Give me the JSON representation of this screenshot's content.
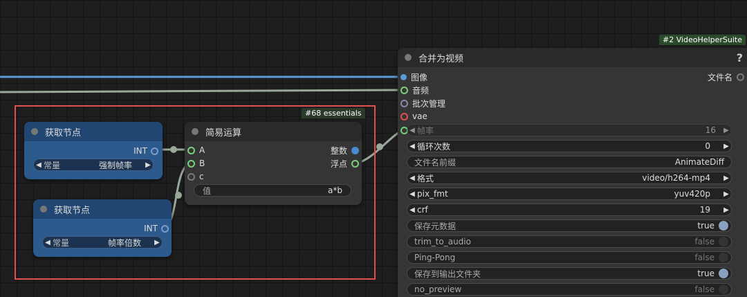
{
  "groups": {
    "essentials_badge": "#68 essentials"
  },
  "node_get1": {
    "title": "获取节点",
    "output": "INT",
    "widget_label": "常量",
    "widget_value": "强制帧率"
  },
  "node_get2": {
    "title": "获取节点",
    "output": "INT",
    "widget_label": "常量",
    "widget_value": "帧率倍数"
  },
  "node_math": {
    "title": "简易运算",
    "inputs": [
      "A",
      "B",
      "c"
    ],
    "outputs": [
      "整数",
      "浮点"
    ],
    "widget_label": "值",
    "widget_value": "a*b"
  },
  "node_video": {
    "badge": "#2 VideoHelperSuite",
    "title": "合并为视频",
    "help": "?",
    "inputs": [
      "图像",
      "音频",
      "批次管理",
      "vae"
    ],
    "output": "文件名",
    "widgets": [
      {
        "label": "帧率",
        "value": "16"
      },
      {
        "label": "循环次数",
        "value": "0"
      },
      {
        "label": "文件名前缀",
        "value": "AnimateDiff"
      },
      {
        "label": "格式",
        "value": "video/h264-mp4"
      },
      {
        "label": "pix_fmt",
        "value": "yuv420p"
      },
      {
        "label": "crf",
        "value": "19"
      },
      {
        "label": "保存元数据",
        "value": "true"
      },
      {
        "label": "trim_to_audio",
        "value": "false"
      },
      {
        "label": "Ping-Pong",
        "value": "false"
      },
      {
        "label": "保存到输出文件夹",
        "value": "true"
      },
      {
        "label": "no_preview",
        "value": "false"
      }
    ]
  },
  "colors": {
    "image_link": "#5a9bd8",
    "audio_link": "#8aa08a",
    "selection": "#e05050",
    "float_slot": "#7ad07a",
    "int_slot": "#4a8ad0"
  }
}
